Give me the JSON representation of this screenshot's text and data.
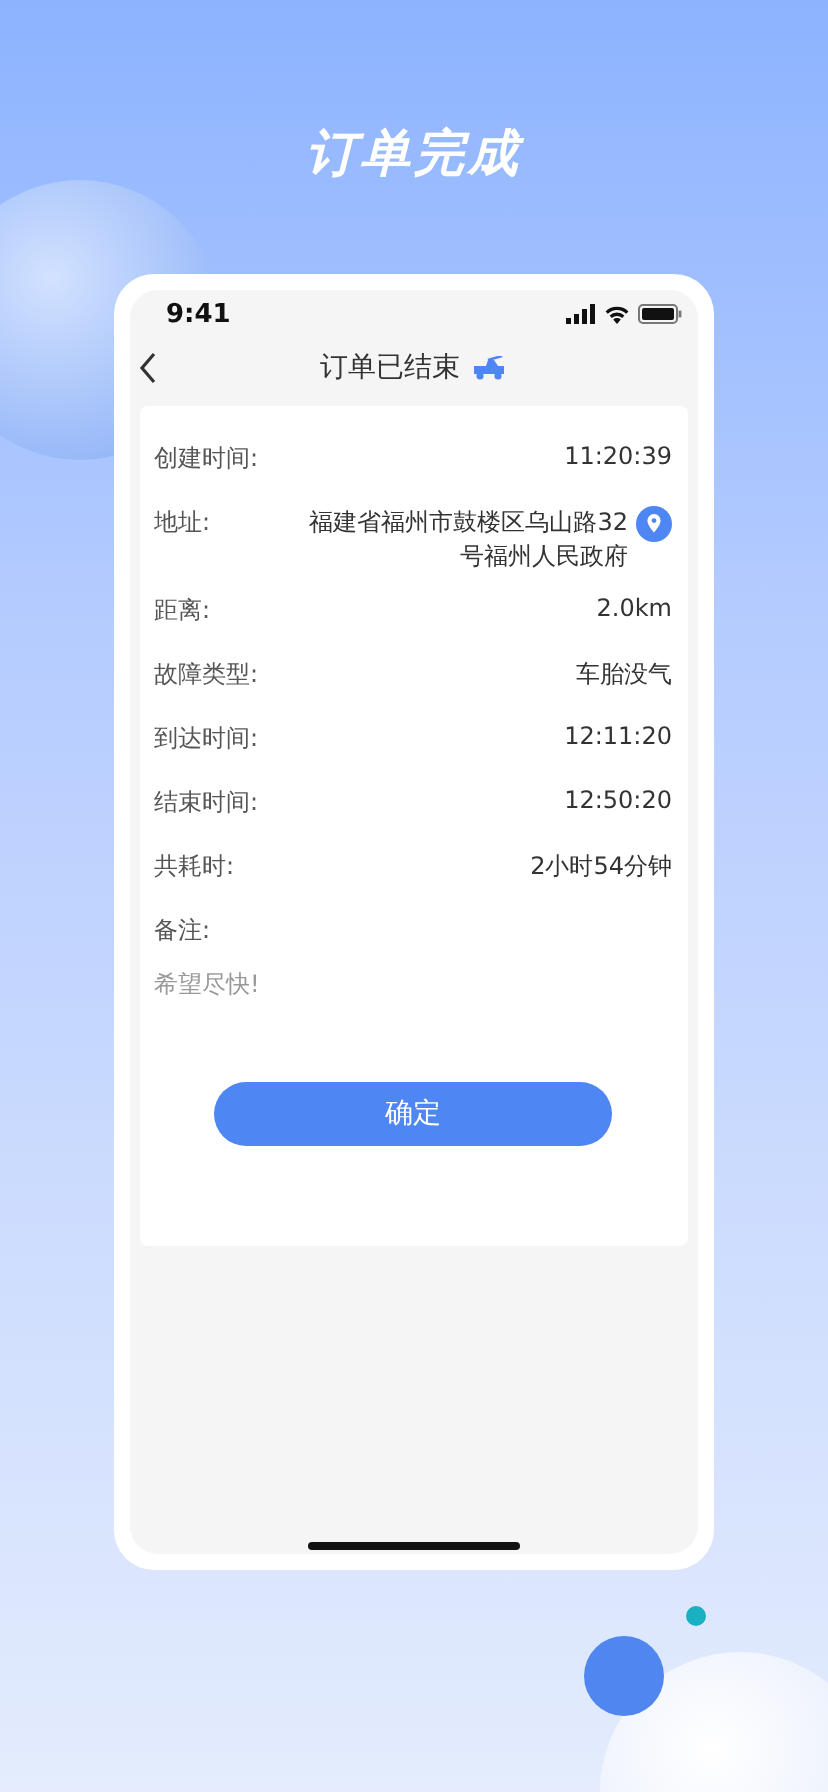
{
  "headline": "订单完成",
  "status_bar": {
    "time": "9:41"
  },
  "nav": {
    "title": "订单已结束"
  },
  "details": [
    {
      "kind": "field",
      "label": "创建时间:",
      "value": "11:20:39"
    },
    {
      "kind": "address",
      "label": "地址:",
      "value": "福建省福州市鼓楼区乌山路32号福州人民政府"
    },
    {
      "kind": "field",
      "label": "距离:",
      "value": "2.0km"
    },
    {
      "kind": "field",
      "label": "故障类型:",
      "value": "车胎没气"
    },
    {
      "kind": "field",
      "label": "到达时间:",
      "value": "12:11:20"
    },
    {
      "kind": "field",
      "label": "结束时间:",
      "value": "12:50:20"
    },
    {
      "kind": "field",
      "label": "共耗时:",
      "value": "2小时54分钟"
    },
    {
      "kind": "note",
      "label": "备注:",
      "value": "希望尽快!"
    }
  ],
  "confirm_button": "确定"
}
